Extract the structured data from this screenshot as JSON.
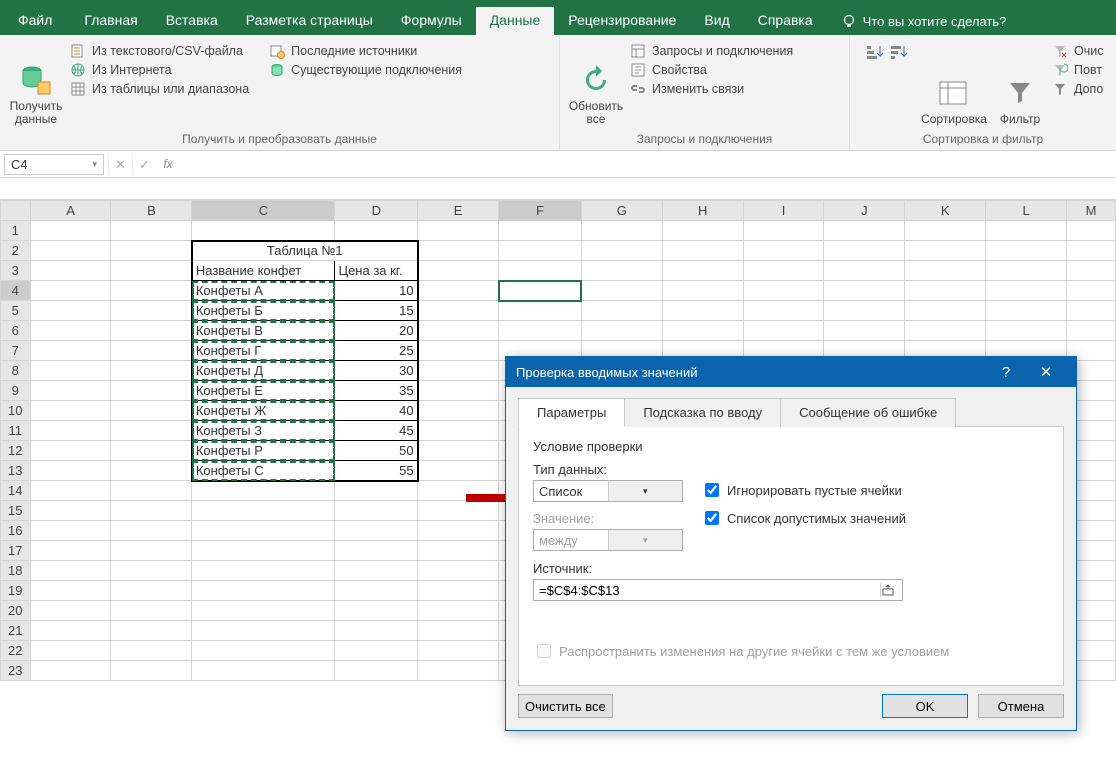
{
  "tabs": {
    "file": "Файл",
    "home": "Главная",
    "insert": "Вставка",
    "layout": "Разметка страницы",
    "formulas": "Формулы",
    "data": "Данные",
    "review": "Рецензирование",
    "view": "Вид",
    "help": "Справка",
    "tellme": "Что вы хотите сделать?"
  },
  "ribbon": {
    "group1": {
      "get_data": "Получить\nданные",
      "from_csv": "Из текстового/CSV-файла",
      "from_web": "Из Интернета",
      "from_range": "Из таблицы или диапазона",
      "recent": "Последние источники",
      "existing": "Существующие подключения",
      "label": "Получить и преобразовать данные"
    },
    "group2": {
      "refresh": "Обновить\nвсе",
      "queries": "Запросы и подключения",
      "props": "Свойства",
      "links": "Изменить связи",
      "label": "Запросы и подключения"
    },
    "group3": {
      "sort": "Сортировка",
      "filter": "Фильтр",
      "clear": "Очис",
      "reapply": "Повт",
      "advanced": "Допо",
      "label": "Сортировка и фильтр"
    }
  },
  "namebox": "C4",
  "grid": {
    "cols": [
      "A",
      "B",
      "C",
      "D",
      "E",
      "F",
      "G",
      "H",
      "I",
      "J",
      "K",
      "L",
      "M"
    ],
    "title": "Таблица №1",
    "h1": "Название конфет",
    "h2": "Цена за кг.",
    "rows": [
      {
        "name": "Конфеты А",
        "price": "10"
      },
      {
        "name": "Конфеты Б",
        "price": "15"
      },
      {
        "name": "Конфеты В",
        "price": "20"
      },
      {
        "name": "Конфеты Г",
        "price": "25"
      },
      {
        "name": "Конфеты Д",
        "price": "30"
      },
      {
        "name": "Конфеты Е",
        "price": "35"
      },
      {
        "name": "Конфеты Ж",
        "price": "40"
      },
      {
        "name": "Конфеты З",
        "price": "45"
      },
      {
        "name": "Конфеты Р",
        "price": "50"
      },
      {
        "name": "Конфеты С",
        "price": "55"
      }
    ]
  },
  "dialog": {
    "title": "Проверка вводимых значений",
    "help": "?",
    "close": "✕",
    "tab1": "Параметры",
    "tab2": "Подсказка по вводу",
    "tab3": "Сообщение об ошибке",
    "cond": "Условие проверки",
    "type_lbl": "Тип данных:",
    "type_val": "Список",
    "value_lbl": "Значение:",
    "value_val": "между",
    "ignore": "Игнорировать пустые ячейки",
    "dropdown": "Список допустимых значений",
    "source_lbl": "Источник:",
    "source_val": "=$C$4:$C$13",
    "spread": "Распространить изменения на другие ячейки с тем же условием",
    "clear": "Очистить все",
    "ok": "OK",
    "cancel": "Отмена"
  }
}
